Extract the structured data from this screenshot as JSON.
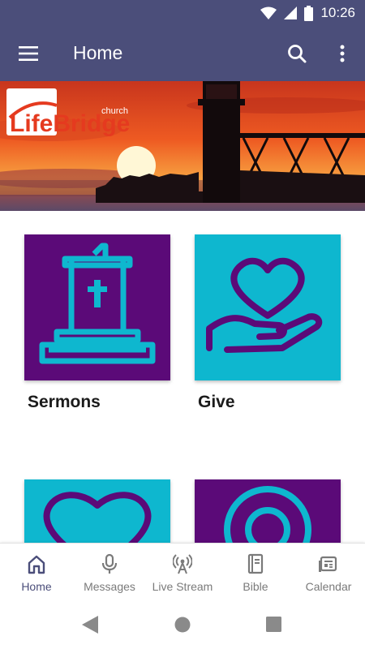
{
  "status_bar": {
    "time": "10:26"
  },
  "app_bar": {
    "title": "Home"
  },
  "banner": {
    "logo_text": "LifeBridge",
    "logo_sub": "church"
  },
  "tiles": [
    {
      "label": "Sermons",
      "icon": "pulpit-icon"
    },
    {
      "label": "Give",
      "icon": "heart-hand-icon"
    },
    {
      "label": "",
      "icon": "heart-icon"
    },
    {
      "label": "",
      "icon": "target-icon"
    }
  ],
  "bottom_nav": {
    "items": [
      {
        "label": "Home",
        "icon": "home-icon",
        "active": true
      },
      {
        "label": "Messages",
        "icon": "microphone-icon"
      },
      {
        "label": "Live Stream",
        "icon": "broadcast-icon"
      },
      {
        "label": "Bible",
        "icon": "bible-icon"
      },
      {
        "label": "Calendar",
        "icon": "calendar-icon"
      }
    ]
  },
  "colors": {
    "primary": "#4b4e7a",
    "purple": "#5b0a78",
    "cyan": "#0eb7cf"
  }
}
